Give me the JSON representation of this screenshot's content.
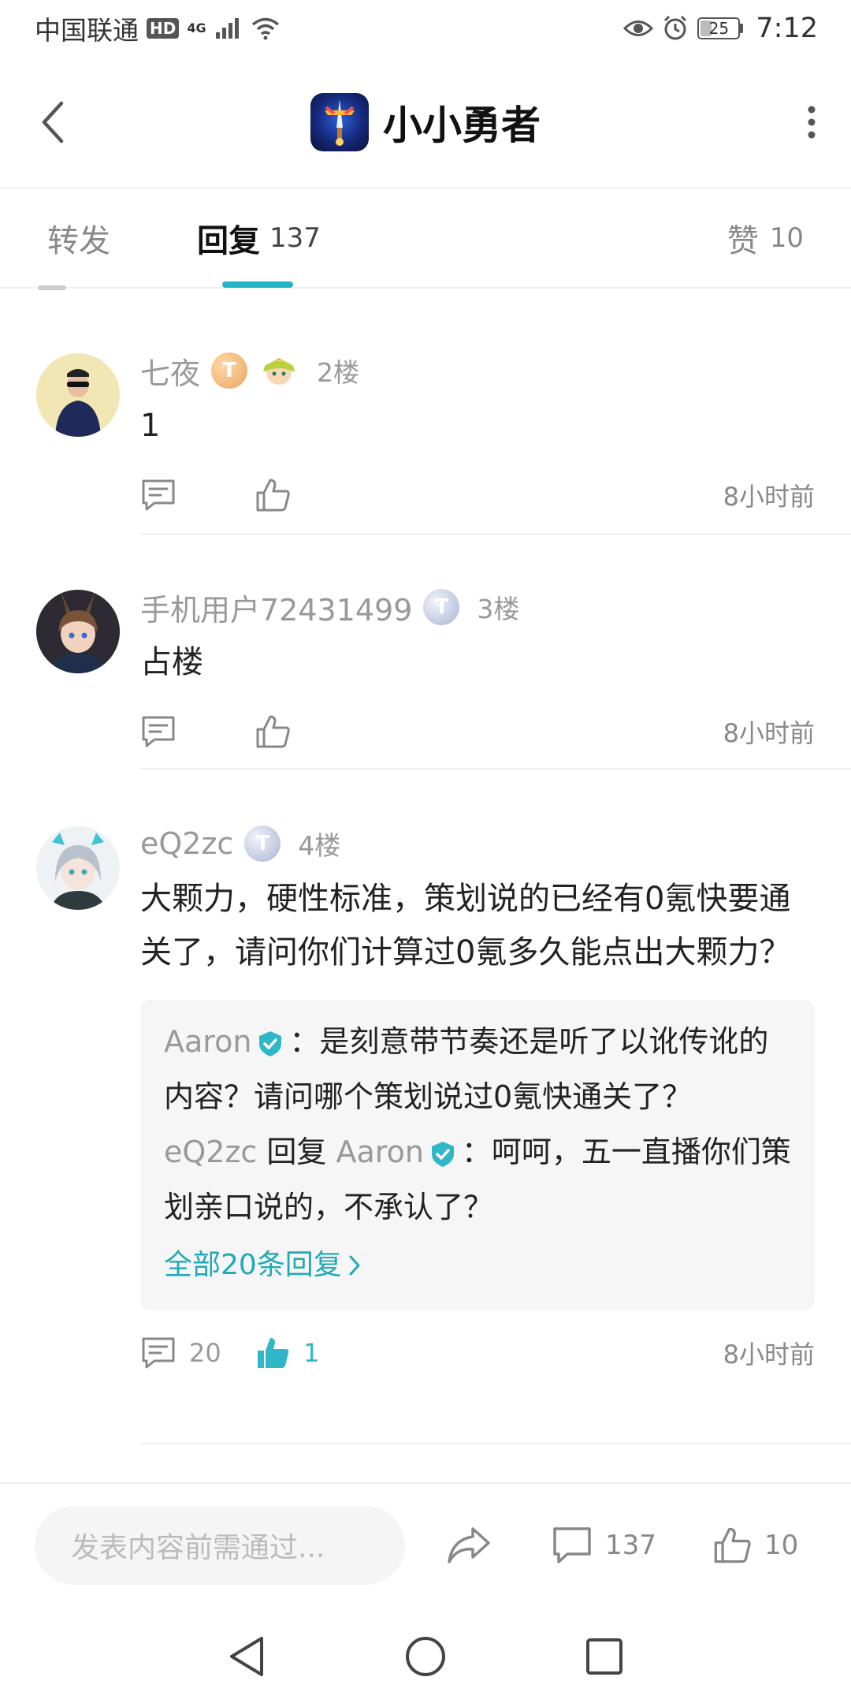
{
  "status_bar": {
    "carrier": "中国联通",
    "hd": "HD",
    "network": "4G",
    "battery": "25",
    "time": "7:12"
  },
  "header": {
    "title": "小小勇者"
  },
  "tabs": {
    "repost_label": "转发",
    "reply_label": "回复",
    "reply_count": "137",
    "like_label": "赞",
    "like_count": "10"
  },
  "comments": [
    {
      "username": "七夜",
      "floor": "2楼",
      "text": "1",
      "time": "8小时前",
      "comment_count": "",
      "like_count": ""
    },
    {
      "username": "手机用户72431499",
      "floor": "3楼",
      "text": "占楼",
      "time": "8小时前",
      "comment_count": "",
      "like_count": ""
    },
    {
      "username": "eQ2zc",
      "floor": "4楼",
      "text": "大颗力，硬性标准，策划说的已经有0氪快要通关了，请问你们计算过0氪多久能点出大颗力？",
      "time": "8小时前",
      "comment_count": "20",
      "like_count": "1",
      "replies": [
        {
          "author": "Aaron",
          "text": "：是刻意带节奏还是听了以讹传讹的内容？请问哪个策划说过0氪快通关了？"
        },
        {
          "author": "eQ2zc",
          "reply_word": "回复",
          "target": "Aaron",
          "text": "：呵呵，五一直播你们策划亲口说的，不承认了？"
        }
      ],
      "all_replies_label": "全部20条回复"
    }
  ],
  "bottom_bar": {
    "input_placeholder": "发表内容前需通过...",
    "comment_count": "137",
    "like_count": "10"
  },
  "colors": {
    "accent": "#22b6c4",
    "liked": "#2fb6c7"
  }
}
